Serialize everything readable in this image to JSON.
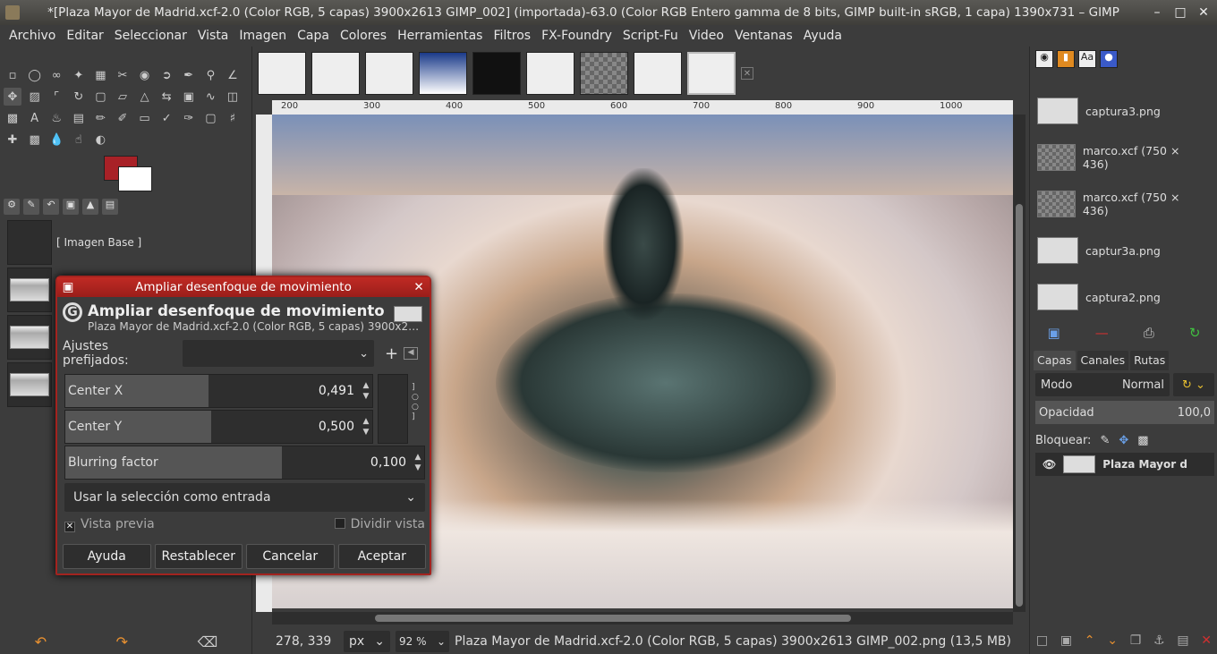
{
  "window": {
    "title": "*[Plaza Mayor de Madrid.xcf-2.0 (Color RGB, 5 capas) 3900x2613  GIMP_002] (importada)-63.0 (Color RGB Entero gamma de 8 bits, GIMP built-in sRGB, 1 capa) 1390x731 – GIMP"
  },
  "menu": [
    "Archivo",
    "Editar",
    "Seleccionar",
    "Vista",
    "Imagen",
    "Capa",
    "Colores",
    "Herramientas",
    "Filtros",
    "FX-Foundry",
    "Script-Fu",
    "Video",
    "Ventanas",
    "Ayuda"
  ],
  "colors": {
    "fg": "#a82127",
    "bg": "#ffffff",
    "accent": "#a3231f"
  },
  "toolbox": {
    "image_base_label": "[ Imagen Base ]"
  },
  "ruler": {
    "h_ticks": [
      "200",
      "300",
      "400",
      "500",
      "600",
      "700",
      "800",
      "900",
      "1000"
    ]
  },
  "status": {
    "coords": "278, 339",
    "unit": "px",
    "zoom": "92 %",
    "info": "Plaza Mayor de Madrid.xcf-2.0 (Color RGB, 5 capas) 3900x2613  GIMP_002.png (13,5 MB)"
  },
  "images": [
    "captura3.png",
    "marco.xcf (750 × 436)",
    "marco.xcf (750 × 436)",
    "captur3a.png",
    "captura2.png"
  ],
  "layers_panel": {
    "tabs": [
      "Capas",
      "Canales",
      "Rutas"
    ],
    "mode_label": "Modo",
    "mode_value": "Normal",
    "opacity_label": "Opacidad",
    "opacity_value": "100,0",
    "lock_label": "Bloquear:",
    "layer_name": "Plaza Mayor d"
  },
  "dialog": {
    "window_title": "Ampliar desenfoque de movimiento",
    "heading": "Ampliar desenfoque de movimiento",
    "subheading": "Plaza Mayor de Madrid.xcf-2.0 (Color RGB, 5 capas) 3900x2…",
    "preset_label": "Ajustes prefijados:",
    "center_x_label": "Center X",
    "center_x_value": "0,491",
    "center_y_label": "Center Y",
    "center_y_value": "0,500",
    "blur_label": "Blurring factor",
    "blur_value": "0,100",
    "selection_option": "Usar la selección como entrada",
    "preview_label": "Vista previa",
    "split_label": "Dividir vista",
    "buttons": {
      "help": "Ayuda",
      "reset": "Restablecer",
      "cancel": "Cancelar",
      "ok": "Aceptar"
    }
  }
}
